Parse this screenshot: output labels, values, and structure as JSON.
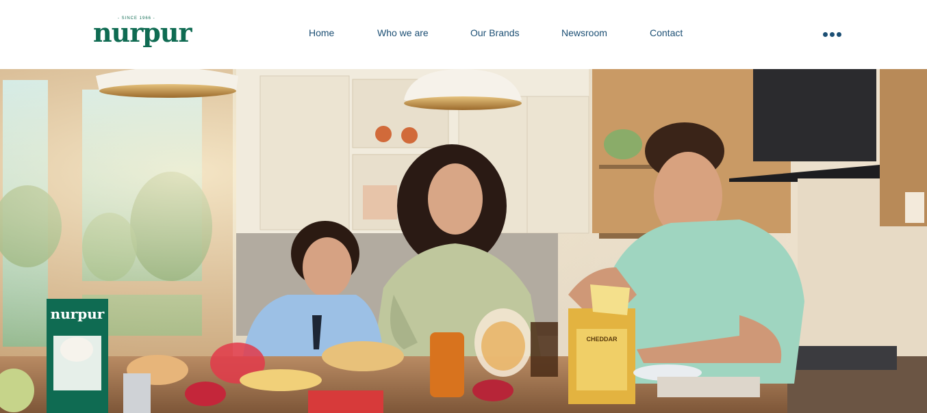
{
  "header": {
    "logo": {
      "tagline": "- SINCE 1966 -",
      "wordmark": "nurpur"
    },
    "nav": [
      {
        "label": "Home"
      },
      {
        "label": "Who we are"
      },
      {
        "label": "Our Brands"
      },
      {
        "label": "Newsroom"
      },
      {
        "label": "Contact"
      }
    ],
    "more_icon": "ellipsis-icon"
  },
  "hero": {
    "milk_pack_brand": "nurpur",
    "cheese_box_label": "CHEDDAR",
    "colors": {
      "brand_green": "#0f6b52",
      "nav_blue": "#1c4f74",
      "cheese_yellow": "#e3b340"
    }
  }
}
